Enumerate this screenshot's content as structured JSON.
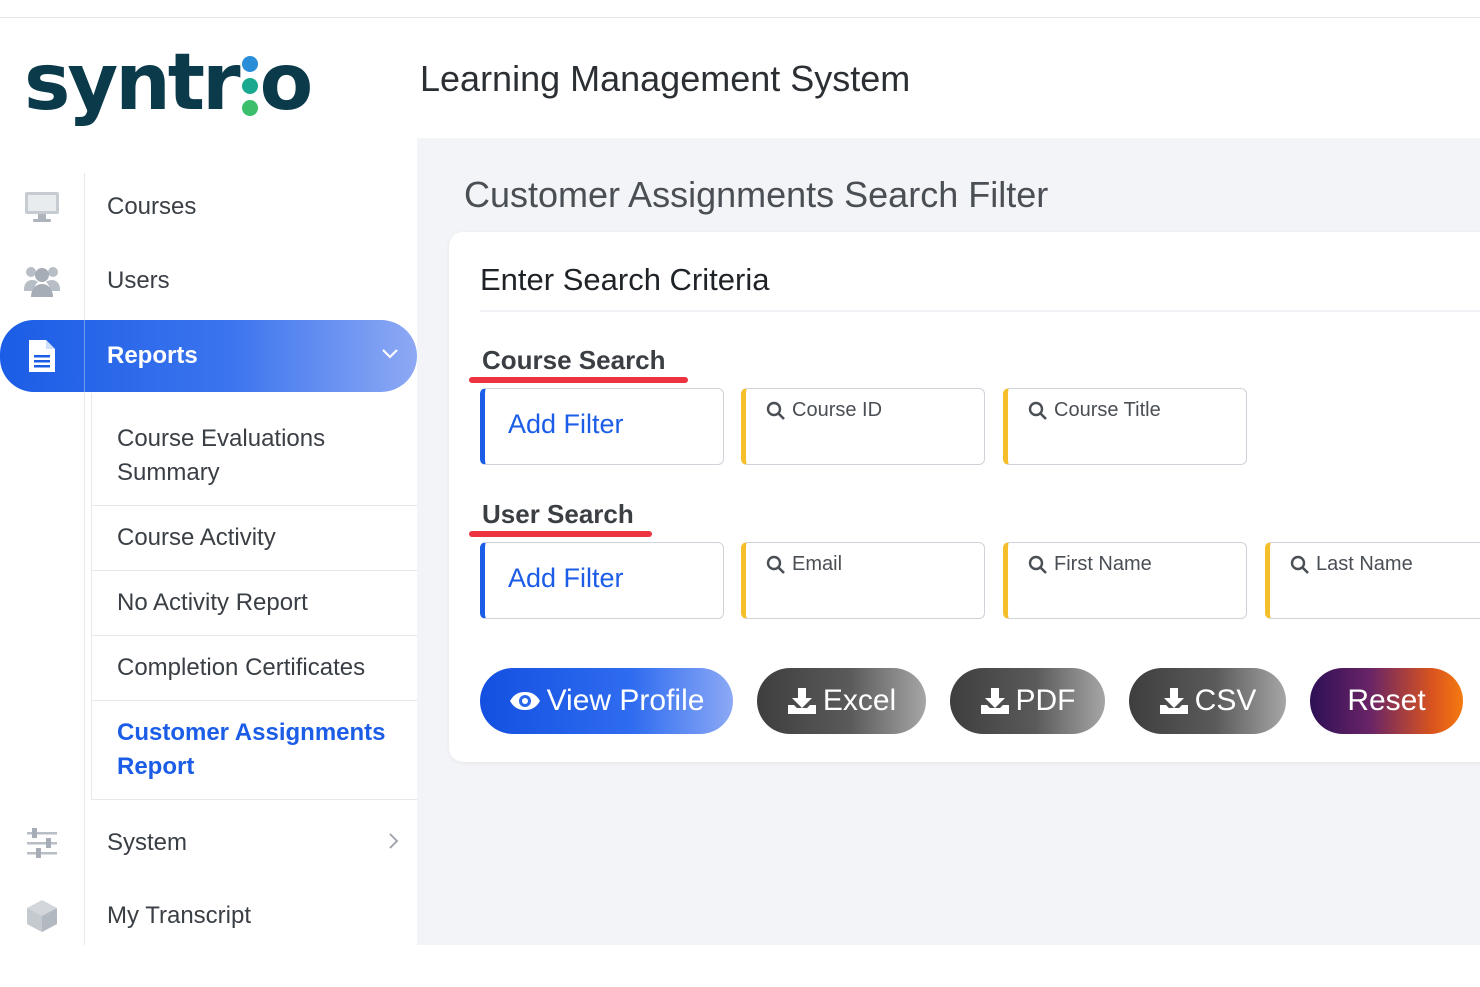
{
  "brand": {
    "logo_part1": "syntr",
    "logo_part2": "o",
    "app_title": "Learning Management System",
    "colors": {
      "logo_text": "#0b3a4a",
      "dot_blue": "#2a8dd8",
      "dot_teal": "#1aa98f",
      "dot_green": "#3bbf6c"
    }
  },
  "sidebar": {
    "items": [
      {
        "label": "Courses",
        "icon": "monitor-icon"
      },
      {
        "label": "Users",
        "icon": "users-icon"
      },
      {
        "label": "Reports",
        "icon": "document-icon",
        "active": true
      },
      {
        "label": "System",
        "icon": "sliders-icon"
      },
      {
        "label": "My Transcript",
        "icon": "cube-icon"
      }
    ],
    "reports_submenu": [
      {
        "label": "Course Evaluations Summary"
      },
      {
        "label": "Course Activity"
      },
      {
        "label": "No Activity Report"
      },
      {
        "label": "Completion Certificates"
      },
      {
        "label": "Customer Assignments Report",
        "current": true
      }
    ]
  },
  "main": {
    "page_title": "Customer Assignments Search Filter",
    "card_title": "Enter Search Criteria",
    "course_search": {
      "label": "Course Search",
      "add_filter": "Add Filter",
      "fields": [
        "Course ID",
        "Course Title"
      ]
    },
    "user_search": {
      "label": "User Search",
      "add_filter": "Add Filter",
      "fields": [
        "Email",
        "First Name",
        "Last Name"
      ]
    },
    "buttons": {
      "view_profile": "View Profile",
      "excel": "Excel",
      "pdf": "PDF",
      "csv": "CSV",
      "reset": "Reset"
    }
  },
  "colors": {
    "primary": "#1b5de6",
    "accent_yellow": "#f4bf2a",
    "highlight_red": "#ee3340"
  }
}
